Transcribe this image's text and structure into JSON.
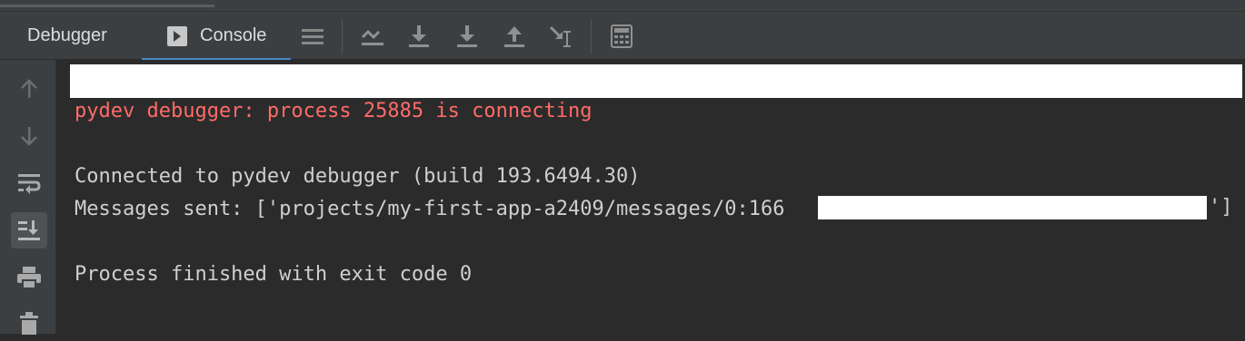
{
  "tabs": [
    {
      "label": "Debugger",
      "active": false
    },
    {
      "label": "Console",
      "active": true,
      "icon": "console-icon"
    }
  ],
  "toolbar_icons": [
    "frames-menu-icon",
    "show-execution-point-icon",
    "step-over-icon",
    "step-into-icon",
    "step-out-icon",
    "run-to-cursor-icon",
    "evaluate-expression-icon"
  ],
  "sidebar_icons": [
    "up-arrow-icon",
    "down-arrow-icon",
    "soft-wrap-icon",
    "scroll-to-end-icon",
    "print-icon",
    "trash-icon"
  ],
  "console": {
    "connecting": "pydev debugger: process 25885 is connecting",
    "connected": "Connected to pydev debugger (build 193.6494.30)",
    "messages_prefix": "Messages sent: ['projects/my-first-app-a2409/messages/0:166",
    "messages_suffix": "']",
    "finished": "Process finished with exit code 0"
  },
  "colors": {
    "error_text": "#ff6b68",
    "accent": "#4a88c7",
    "background": "#2b2b2b"
  }
}
